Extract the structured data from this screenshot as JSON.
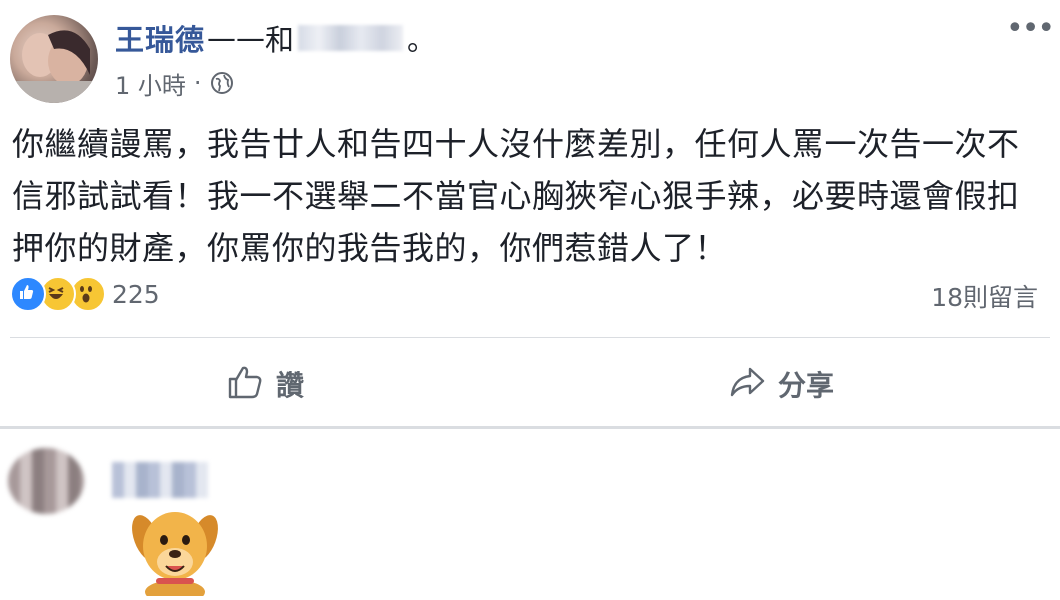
{
  "post": {
    "author": "王瑞德",
    "dash": "——",
    "with": "和",
    "period": "。",
    "timestamp": "1 小時",
    "dot": "·",
    "more": "•••",
    "text": "你繼續謾罵，我告廿人和告四十人沒什麼差別，任何人罵一次告一次不\n信邪試試看！我一不選舉二不當官心胸狹窄心狠手辣，必要時還會假扣\n押你的財產，你罵你的我告我的，你們惹錯人了！"
  },
  "reactions": {
    "count": "225",
    "comments": "18則留言",
    "types": [
      "like",
      "haha",
      "wow"
    ]
  },
  "actions": {
    "like_label": "讚",
    "share_label": "分享"
  },
  "colors": {
    "author_link": "#365899",
    "like_blue": "#2d88ff",
    "emoji_yellow": "#f7c634",
    "muted_text": "#616770"
  },
  "icons": {
    "globe": "globe-icon",
    "like": "thumbs-up-icon",
    "share": "share-arrow-icon",
    "more": "more-options-icon"
  }
}
